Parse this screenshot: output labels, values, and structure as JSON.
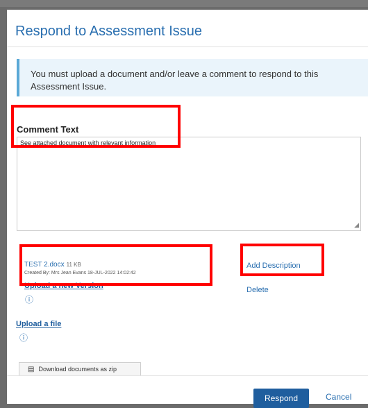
{
  "dialog": {
    "title": "Respond to Assessment Issue",
    "info_message": "You must upload a document and/or leave a comment to respond to this Assessment Issue.",
    "comment_label": "Comment Text",
    "comment_value": "See attached document with relevant information",
    "file": {
      "name": "TEST 2.docx",
      "size": "11 KB",
      "meta": "Created By: Mrs Jean Evans 18-JUL-2022 14:02:42",
      "upload_version_label": "Upload a new Version",
      "add_description_label": "Add Description",
      "delete_label": "Delete"
    },
    "upload_file_label": "Upload a file",
    "zip_button_label": "Download documents as zip",
    "respond_label": "Respond",
    "cancel_label": "Cancel"
  },
  "colors": {
    "accent": "#2a6fb0",
    "primary_button": "#1f5e9e",
    "highlight": "#ff0000"
  },
  "icons": [
    "info-circle-icon",
    "document-icon",
    "resize-handle-icon"
  ]
}
